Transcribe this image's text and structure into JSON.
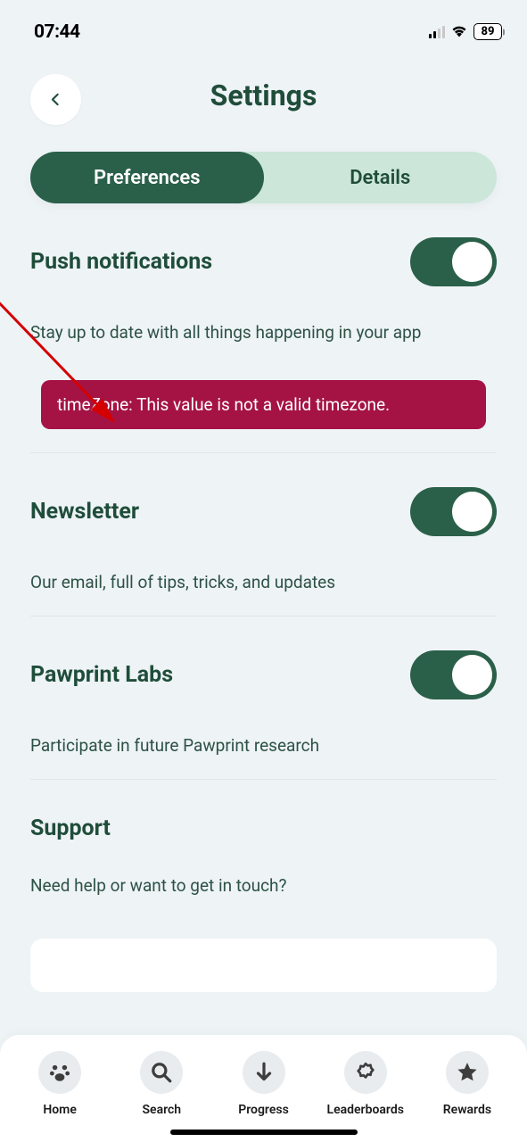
{
  "status_bar": {
    "time": "07:44",
    "battery": "89"
  },
  "header": {
    "title": "Settings"
  },
  "tabs": {
    "preferences": "Preferences",
    "details": "Details"
  },
  "settings": {
    "push": {
      "title": "Push notifications",
      "desc": "Stay up to date with all things happening in your app"
    },
    "error": "timeZone: This value is not a valid timezone.",
    "newsletter": {
      "title": "Newsletter",
      "desc": "Our email, full of tips, tricks, and updates"
    },
    "labs": {
      "title": "Pawprint Labs",
      "desc": "Participate in future Pawprint research"
    },
    "support": {
      "title": "Support",
      "desc": "Need help or want to get in touch?"
    }
  },
  "navbar": {
    "home": "Home",
    "search": "Search",
    "progress": "Progress",
    "leaderboards": "Leaderboards",
    "rewards": "Rewards"
  }
}
